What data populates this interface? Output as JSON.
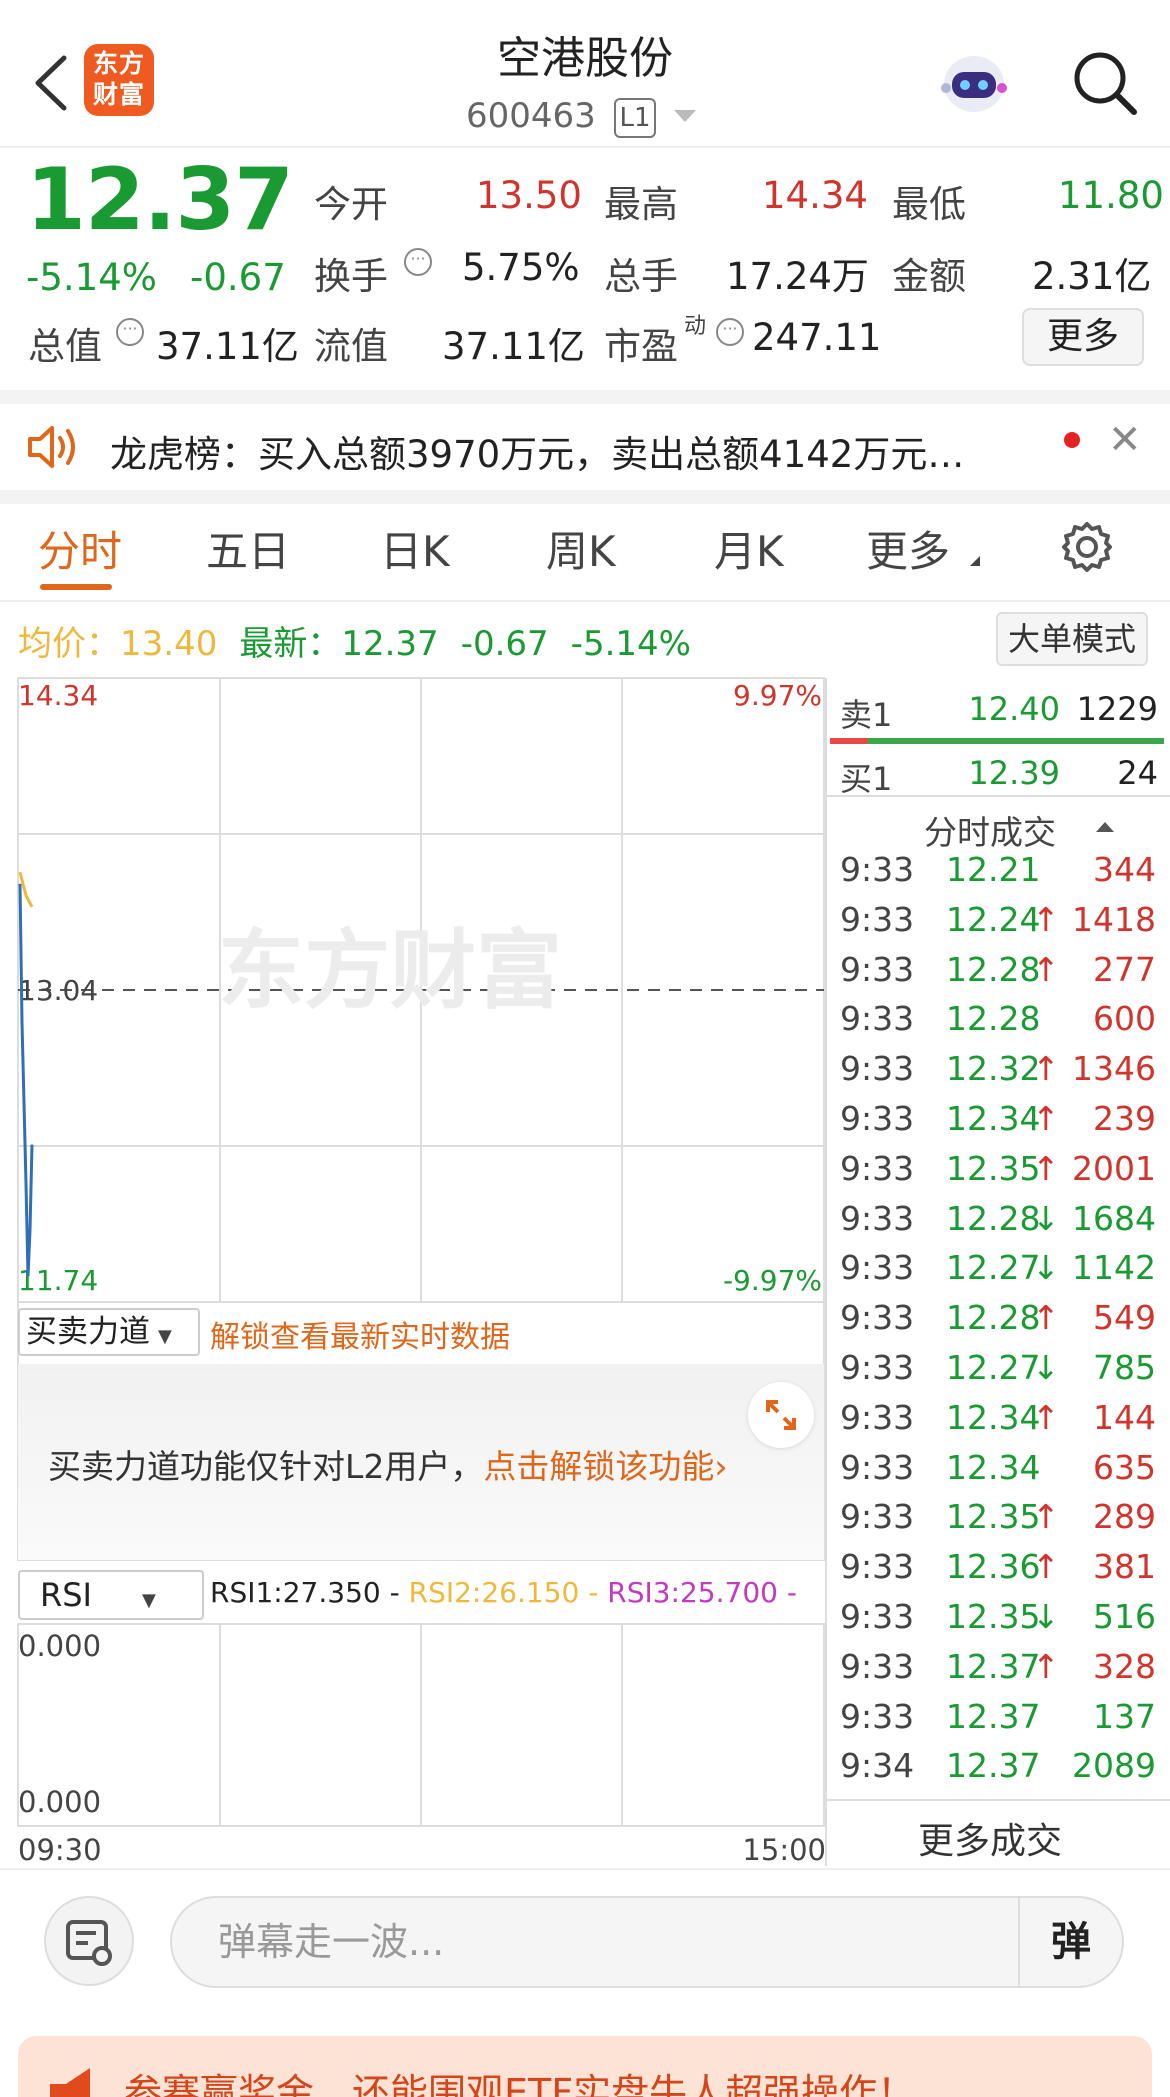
{
  "header": {
    "logo_text_line1": "东方",
    "logo_text_line2": "财富",
    "stock_name": "空港股份",
    "stock_code": "600463",
    "level_badge": "L1"
  },
  "quote": {
    "price": "12.37",
    "change_pct": "-5.14%",
    "change_amt": "-0.67",
    "fields": [
      {
        "label": "今开",
        "value": "13.50",
        "tone": "red"
      },
      {
        "label": "最高",
        "value": "14.34",
        "tone": "red"
      },
      {
        "label": "最低",
        "value": "11.80",
        "tone": "green"
      },
      {
        "label": "换手",
        "value": "5.75%",
        "tone": "neutral"
      },
      {
        "label": "总手",
        "value": "17.24万",
        "tone": "neutral"
      },
      {
        "label": "金额",
        "value": "2.31亿",
        "tone": "neutral"
      },
      {
        "label": "总值",
        "value": "37.11亿",
        "tone": "neutral"
      },
      {
        "label": "流值",
        "value": "37.11亿",
        "tone": "neutral"
      },
      {
        "label": "市盈",
        "label_sup": "动",
        "value": "247.11",
        "tone": "neutral"
      }
    ],
    "more_label": "更多"
  },
  "news": {
    "text": "龙虎榜：买入总额3970万元，卖出总额4142万元…",
    "close": "✕"
  },
  "tabs": [
    {
      "label": "分时",
      "active": true
    },
    {
      "label": "五日",
      "active": false
    },
    {
      "label": "日K",
      "active": false
    },
    {
      "label": "周K",
      "active": false
    },
    {
      "label": "月K",
      "active": false
    },
    {
      "label": "更多",
      "active": false
    }
  ],
  "stat_line": {
    "avg_label": "均价：",
    "avg_value": "13.40",
    "latest_label": "最新：",
    "latest_value": "12.37",
    "latest_change": "-0.67",
    "latest_pct": "-5.14%",
    "big_order_label": "大单模式"
  },
  "chart": {
    "y_max_label": "14.34",
    "y_min_label": "11.74",
    "y_mid_label": "13.04",
    "pct_max_label": "9.97%",
    "pct_min_label": "-9.97%",
    "watermark": "东方财富",
    "price_color": "#2f6fb8",
    "avg_color": "#f0b83a",
    "chart_data": {
      "type": "line",
      "ylim": [
        11.74,
        14.34
      ],
      "prev_close": 13.04,
      "series": [
        {
          "values": [
            13.5,
            12.9,
            12.2,
            11.8,
            12.0,
            12.37
          ]
        },
        {
          "values": [
            13.55,
            13.45,
            13.4
          ]
        }
      ]
    }
  },
  "order_book": {
    "ask": {
      "label": "卖1",
      "price": "12.40",
      "volume": "1229"
    },
    "bid": {
      "label": "买1",
      "price": "12.39",
      "volume": "24"
    },
    "trades_title": "分时成交",
    "trades": [
      {
        "time": "9:33",
        "price": "12.21",
        "arrow": "",
        "vol": "344",
        "price_tone": "green",
        "vol_tone": "red"
      },
      {
        "time": "9:33",
        "price": "12.24",
        "arrow": "↑",
        "vol": "1418",
        "price_tone": "green",
        "vol_tone": "red"
      },
      {
        "time": "9:33",
        "price": "12.28",
        "arrow": "↑",
        "vol": "277",
        "price_tone": "green",
        "vol_tone": "red"
      },
      {
        "time": "9:33",
        "price": "12.28",
        "arrow": "",
        "vol": "600",
        "price_tone": "green",
        "vol_tone": "red"
      },
      {
        "time": "9:33",
        "price": "12.32",
        "arrow": "↑",
        "vol": "1346",
        "price_tone": "green",
        "vol_tone": "red"
      },
      {
        "time": "9:33",
        "price": "12.34",
        "arrow": "↑",
        "vol": "239",
        "price_tone": "green",
        "vol_tone": "red"
      },
      {
        "time": "9:33",
        "price": "12.35",
        "arrow": "↑",
        "vol": "2001",
        "price_tone": "green",
        "vol_tone": "red"
      },
      {
        "time": "9:33",
        "price": "12.28",
        "arrow": "↓",
        "vol": "1684",
        "price_tone": "green",
        "vol_tone": "green"
      },
      {
        "time": "9:33",
        "price": "12.27",
        "arrow": "↓",
        "vol": "1142",
        "price_tone": "green",
        "vol_tone": "green"
      },
      {
        "time": "9:33",
        "price": "12.28",
        "arrow": "↑",
        "vol": "549",
        "price_tone": "green",
        "vol_tone": "red"
      },
      {
        "time": "9:33",
        "price": "12.27",
        "arrow": "↓",
        "vol": "785",
        "price_tone": "green",
        "vol_tone": "green"
      },
      {
        "time": "9:33",
        "price": "12.34",
        "arrow": "↑",
        "vol": "144",
        "price_tone": "green",
        "vol_tone": "red"
      },
      {
        "time": "9:33",
        "price": "12.34",
        "arrow": "",
        "vol": "635",
        "price_tone": "green",
        "vol_tone": "red"
      },
      {
        "time": "9:33",
        "price": "12.35",
        "arrow": "↑",
        "vol": "289",
        "price_tone": "green",
        "vol_tone": "red"
      },
      {
        "time": "9:33",
        "price": "12.36",
        "arrow": "↑",
        "vol": "381",
        "price_tone": "green",
        "vol_tone": "red"
      },
      {
        "time": "9:33",
        "price": "12.35",
        "arrow": "↓",
        "vol": "516",
        "price_tone": "green",
        "vol_tone": "green"
      },
      {
        "time": "9:33",
        "price": "12.37",
        "arrow": "↑",
        "vol": "328",
        "price_tone": "green",
        "vol_tone": "red"
      },
      {
        "time": "9:33",
        "price": "12.37",
        "arrow": "",
        "vol": "137",
        "price_tone": "green",
        "vol_tone": "green"
      },
      {
        "time": "9:34",
        "price": "12.37",
        "arrow": "",
        "vol": "2089",
        "price_tone": "green",
        "vol_tone": "green"
      }
    ],
    "more_trades_label": "更多成交"
  },
  "buy_sell": {
    "select_label": "买卖力道",
    "unlock_text": "解锁查看最新实时数据",
    "panel_text": "买卖力道功能仅针对L2用户，",
    "panel_link": "点击解锁该功能"
  },
  "rsi": {
    "select_label": "RSI",
    "rsi1": "RSI1:27.350 - ",
    "rsi2": "RSI2:26.150 - ",
    "rsi3": "RSI3:25.700 -",
    "rsi1_color": "#222222",
    "rsi2_color": "#f0b83a",
    "rsi3_color": "#c23ac2",
    "top_label": "0.000",
    "bottom_label": "0.000"
  },
  "time_axis": {
    "start": "09:30",
    "end": "15:00"
  },
  "bottom": {
    "comment_placeholder": "弹幕走一波...",
    "danmu_label": "弹"
  },
  "promo": {
    "text": "参赛赢奖金，还能围观ETF实盘牛人超强操作！"
  }
}
